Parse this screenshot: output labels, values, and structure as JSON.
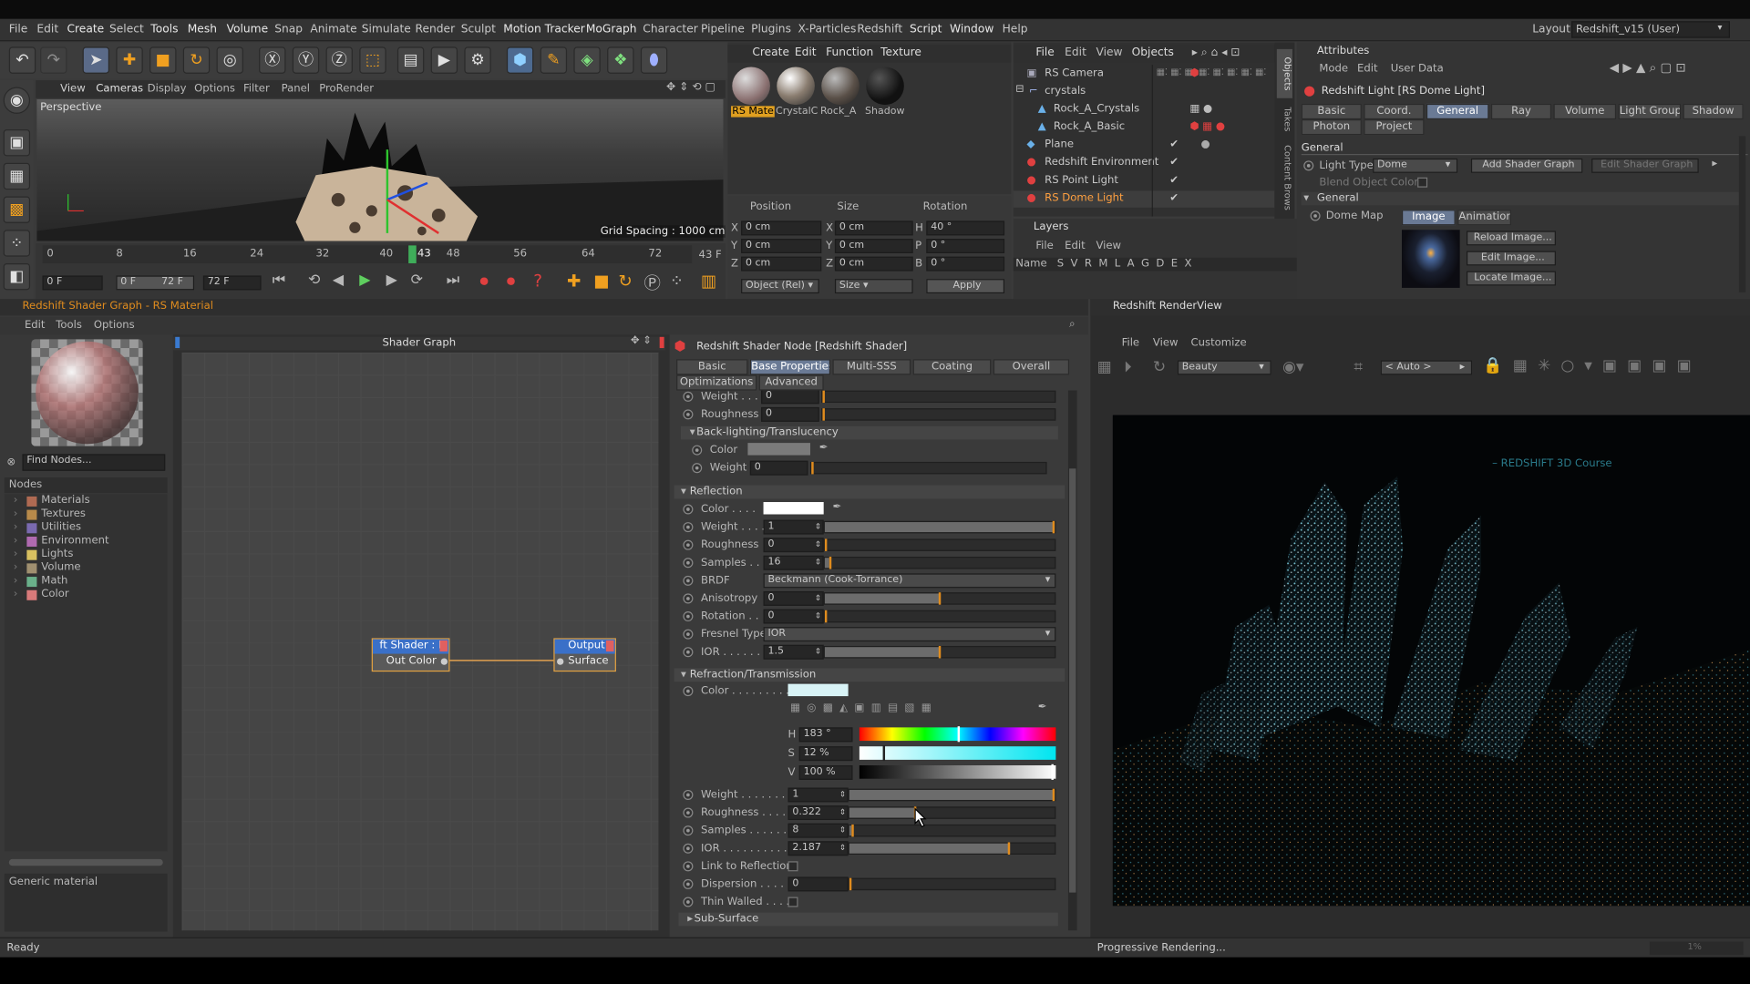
{
  "menu": [
    "File",
    "Edit",
    "Create",
    "Select",
    "Tools",
    "Mesh",
    "Volume",
    "Snap",
    "Animate",
    "Simulate",
    "Render",
    "Sculpt",
    "Motion Tracker",
    "MoGraph",
    "Character",
    "Pipeline",
    "Plugins",
    "X-Particles",
    "Redshift",
    "Script",
    "Window",
    "Help"
  ],
  "layout_label": "Layout:",
  "layout_value": "Redshift_v15 (User)",
  "viewport": {
    "menu": [
      "View",
      "Cameras",
      "Display",
      "Options",
      "Filter",
      "Panel",
      "ProRender"
    ],
    "name": "Perspective",
    "grid": "Grid Spacing : 1000 cm"
  },
  "timeline": {
    "ticks": [
      "0",
      "8",
      "16",
      "24",
      "32",
      "40",
      "43",
      "48",
      "56",
      "64",
      "72"
    ],
    "end": "43 F",
    "start_field": "0 F",
    "range_a": "0 F",
    "range_b": "72 F",
    "end_field": "72 F"
  },
  "material_manager": {
    "menu": [
      "Create",
      "Edit",
      "Function",
      "Texture"
    ],
    "items": [
      "RS Mate",
      "CrystalC",
      "Rock_A",
      "Shadow"
    ]
  },
  "coords": {
    "headers": [
      "Position",
      "Size",
      "Rotation"
    ],
    "pos": [
      [
        "X",
        "0 cm"
      ],
      [
        "Y",
        "0 cm"
      ],
      [
        "Z",
        "0 cm"
      ]
    ],
    "size": [
      [
        "X",
        "0 cm"
      ],
      [
        "Y",
        "0 cm"
      ],
      [
        "Z",
        "0 cm"
      ]
    ],
    "rot": [
      [
        "H",
        "40 °"
      ],
      [
        "P",
        "0 °"
      ],
      [
        "B",
        "0 °"
      ]
    ],
    "mode": "Object (Rel)",
    "size_mode": "Size",
    "apply": "Apply"
  },
  "objects": {
    "menu": [
      "File",
      "Edit",
      "View",
      "Objects"
    ],
    "items": [
      "RS Camera",
      "crystals",
      "Rock_A_Crystals",
      "Rock_A_Basic",
      "Plane",
      "Redshift Environment",
      "RS Point Light",
      "RS Dome Light"
    ]
  },
  "side_tabs": [
    "Objects",
    "Takes",
    "Content Brows"
  ],
  "layers": {
    "title": "Layers",
    "menu": [
      "File",
      "Edit",
      "View"
    ],
    "cols": "Name   S  V  R  M  L  A  G  D  E  X"
  },
  "attributes": {
    "title": "Attributes",
    "menu": [
      "Mode",
      "Edit",
      "User Data"
    ],
    "object": "Redshift Light [RS Dome Light]",
    "tabs_row1": [
      "Basic",
      "Coord.",
      "General",
      "Ray",
      "Volume",
      "Light Group",
      "Shadow"
    ],
    "tabs_row2": [
      "Photon",
      "Project"
    ],
    "section": "General",
    "light_type_label": "Light Type",
    "light_type": "Dome",
    "add_graph": "Add Shader Graph",
    "edit_graph": "Edit Shader Graph",
    "blend": "Blend Object Color",
    "sub": "General",
    "dome_map": "Dome Map",
    "map_tabs": [
      "Image",
      "Animation"
    ],
    "buttons": [
      "Reload Image...",
      "Edit Image...",
      "Locate Image..."
    ]
  },
  "shader_window": {
    "title": "Redshift Shader Graph - RS Material",
    "menu": [
      "Edit",
      "Tools",
      "Options"
    ],
    "find": "Find Nodes...",
    "nodes_label": "Nodes",
    "categories": [
      {
        "name": "Materials",
        "color": "#b06a52"
      },
      {
        "name": "Textures",
        "color": "#b88a4a"
      },
      {
        "name": "Utilities",
        "color": "#7a6ab0"
      },
      {
        "name": "Environment",
        "color": "#b06ab0"
      },
      {
        "name": "Lights",
        "color": "#d8c060"
      },
      {
        "name": "Volume",
        "color": "#a09070"
      },
      {
        "name": "Math",
        "color": "#6ab08a"
      },
      {
        "name": "Color",
        "color": "#d87a7a"
      }
    ],
    "description": "Generic material",
    "graph_title": "Shader Graph",
    "node1_title": "ft Shader : M",
    "node1_port": "Out Color",
    "node2_title": "Output",
    "node2_port": "Surface"
  },
  "shader_node": {
    "title": "Redshift Shader Node [Redshift Shader]",
    "tabs": [
      "Basic",
      "Base Properties",
      "Multi-SSS",
      "Coating",
      "Overall"
    ],
    "tabs2": [
      "Optimizations",
      "Advanced"
    ],
    "top": [
      {
        "label": "Weight . . .",
        "val": "0"
      },
      {
        "label": "Roughness",
        "val": "0"
      }
    ],
    "backlight": {
      "title": "Back-lighting/Translucency",
      "color": "Color",
      "weight_label": "Weight",
      "weight": "0"
    },
    "reflection": {
      "title": "Reflection",
      "color": "Color . . . .",
      "rows": [
        {
          "label": "Weight . . . .",
          "val": "1",
          "fill": 1.0
        },
        {
          "label": "Roughness",
          "val": "0",
          "fill": 0
        },
        {
          "label": "Samples . . .",
          "val": "16",
          "fill": 0.02
        },
        {
          "label": "BRDF",
          "val": "Beckmann (Cook-Torrance)",
          "dropdown": true
        },
        {
          "label": "Anisotropy",
          "val": "0",
          "fill": 0.5
        },
        {
          "label": "Rotation . .",
          "val": "0",
          "fill": 0
        },
        {
          "label": "Fresnel Type",
          "val": "IOR",
          "dropdown": true
        },
        {
          "label": "IOR . . . . . .",
          "val": "1.5",
          "fill": 0.5
        }
      ]
    },
    "refraction": {
      "title": "Refraction/Transmission",
      "color": "Color . . . . . . . . .",
      "hsv": [
        {
          "k": "H",
          "v": "183 °"
        },
        {
          "k": "S",
          "v": "12 %"
        },
        {
          "k": "V",
          "v": "100 %"
        }
      ],
      "rows": [
        {
          "label": "Weight . . . . . . . .",
          "val": "1",
          "fill": 1.0
        },
        {
          "label": "Roughness . . . . .",
          "val": "0.322",
          "fill": 0.32
        },
        {
          "label": "Samples . . . . . .",
          "val": "8",
          "fill": 0.01
        },
        {
          "label": "IOR . . . . . . . . . .",
          "val": "2.187",
          "fill": 0.78
        }
      ],
      "link": "Link to Reflection",
      "dispersion_label": "Dispersion . . . . .",
      "dispersion": "0",
      "thin": "Thin Walled . . . .",
      "sub": "Sub-Surface"
    }
  },
  "renderview": {
    "title": "Redshift RenderView",
    "menu": [
      "File",
      "View",
      "Customize"
    ],
    "aov": "Beauty",
    "auto": "< Auto >",
    "watermark": "– REDSHIFT 3D Course",
    "status": "Progressive Rendering...",
    "percent": "1%"
  },
  "status": "Ready",
  "colors": {
    "accent": "#6a7a95",
    "orange": "#e08c1e",
    "refraction_color": "#d8f3f6"
  }
}
